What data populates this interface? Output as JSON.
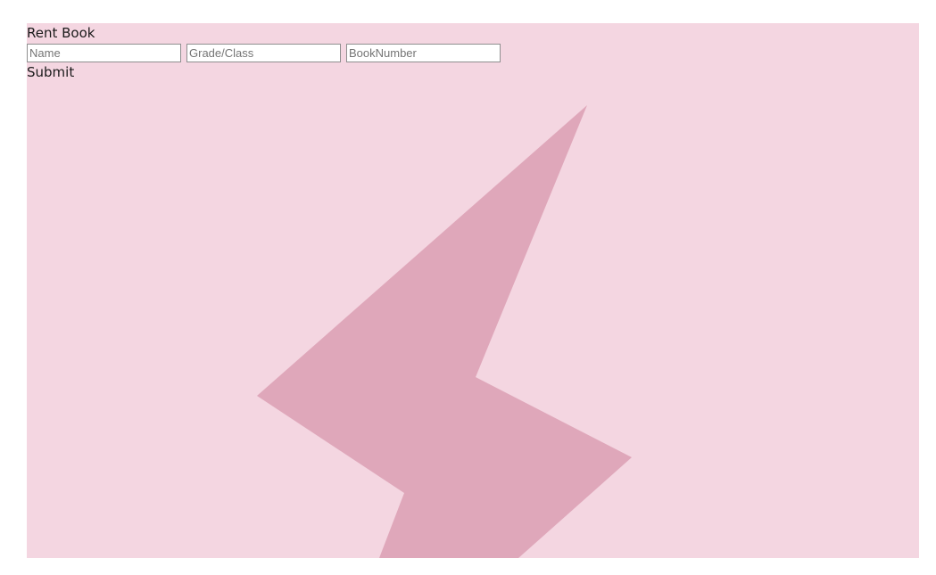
{
  "form": {
    "title": "Rent Book",
    "name_placeholder": "Name",
    "grade_placeholder": "Grade/Class",
    "book_placeholder": "BookNumber",
    "submit_label": "Submit"
  },
  "colors": {
    "panel_background": "#f4d6e1",
    "bolt_fill": "#dfa7ba"
  }
}
